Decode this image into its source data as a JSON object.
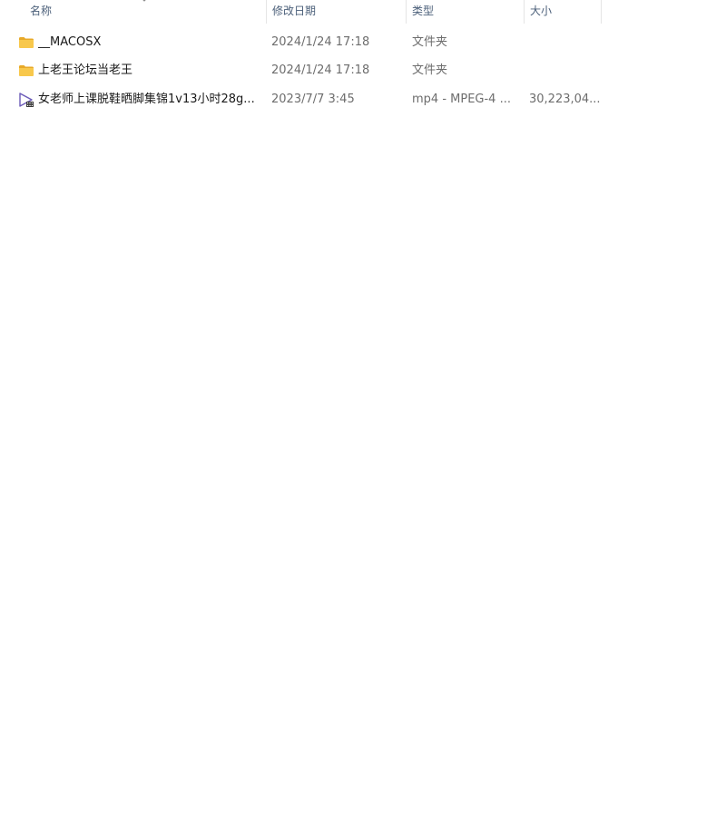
{
  "columns": {
    "name": "名称",
    "date": "修改日期",
    "type": "类型",
    "size": "大小"
  },
  "sort_icon": "chevron-up-icon",
  "files": [
    {
      "icon": "folder-icon",
      "name": "__MACOSX",
      "date": "2024/1/24 17:18",
      "type": "文件夹",
      "size": ""
    },
    {
      "icon": "folder-icon",
      "name": "上老王论坛当老王",
      "date": "2024/1/24 17:18",
      "type": "文件夹",
      "size": ""
    },
    {
      "icon": "video-file-icon",
      "name": "女老师上课脱鞋晒脚集锦1v13小时28g...",
      "date": "2023/7/7 3:45",
      "type": "mp4 - MPEG-4 ...",
      "size": "30,223,04..."
    }
  ],
  "colors": {
    "folder": "#F8C84C",
    "folder_dark": "#E8A928",
    "video": "#6B5BB8"
  }
}
